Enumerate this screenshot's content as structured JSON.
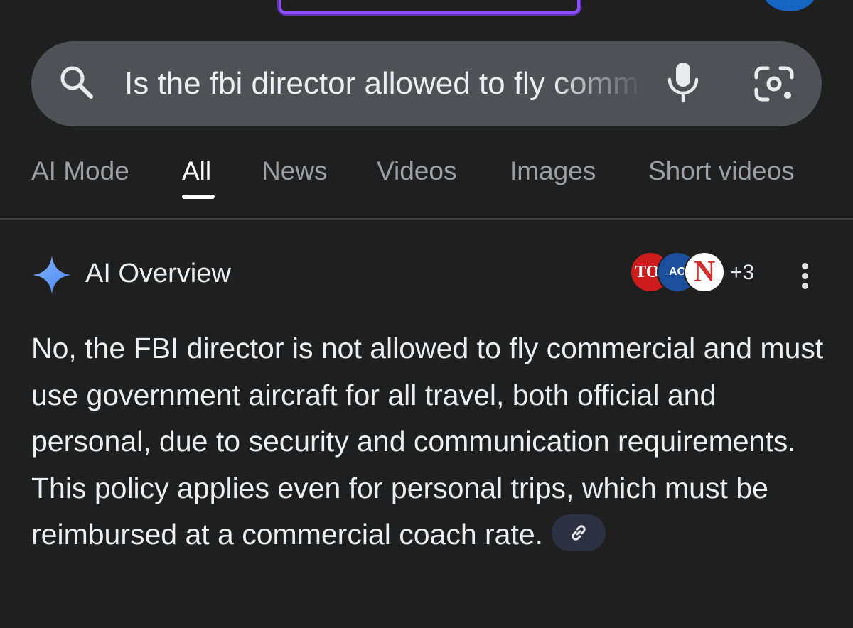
{
  "search": {
    "query": "Is the fbi director allowed to fly commercial"
  },
  "tabs": [
    {
      "label": "AI Mode",
      "active": false
    },
    {
      "label": "All",
      "active": true
    },
    {
      "label": "News",
      "active": false
    },
    {
      "label": "Videos",
      "active": false
    },
    {
      "label": "Images",
      "active": false
    },
    {
      "label": "Short videos",
      "active": false
    }
  ],
  "overview": {
    "title": "AI Overview",
    "sources": [
      {
        "logo_text": "TOI",
        "color": "#cc1c1c"
      },
      {
        "logo_text": "AO",
        "color": "#1b4f9c"
      },
      {
        "logo_text": "N",
        "color": "#d32f2f"
      }
    ],
    "more_sources": "+3",
    "answer": "No, the FBI director is not allowed to fly commercial and must use government aircraft for all travel, both official and personal, due to security and communication requirements. This policy applies even for personal trips, which must be reimbursed at a commercial coach rate."
  },
  "icons": {
    "search": "search-icon",
    "mic": "mic-icon",
    "lens": "lens-icon",
    "sparkle": "sparkle-icon",
    "more": "more-vert-icon",
    "link": "link-icon"
  },
  "colors": {
    "background": "#1f1f1f",
    "search_bar": "#4e5257",
    "sparkle": "#4285f4",
    "accent_border": "#8b4dff"
  }
}
